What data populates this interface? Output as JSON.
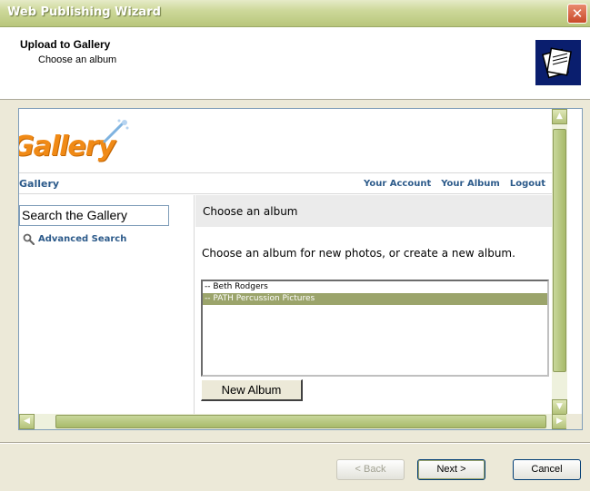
{
  "window": {
    "title": "Web Publishing Wizard",
    "close_label": "✕"
  },
  "header": {
    "title": "Upload to Gallery",
    "subtitle": "Choose an album"
  },
  "gallery": {
    "logo_text": "Gallery",
    "nav": {
      "home_label": "Gallery",
      "links": [
        "Your Account",
        "Your Album",
        "Logout"
      ]
    },
    "sidebar": {
      "search_value": "Search the Gallery",
      "advanced_search_label": "Advanced Search"
    },
    "main": {
      "heading": "Choose an album",
      "description": "Choose an album for new photos, or create a new album.",
      "albums": [
        {
          "label": "-- Beth Rodgers",
          "selected": false
        },
        {
          "label": "-- PATH Percussion Pictures",
          "selected": true
        }
      ],
      "new_album_label": "New Album"
    }
  },
  "footer": {
    "back_label": "< Back",
    "next_label": "Next >",
    "cancel_label": "Cancel"
  }
}
